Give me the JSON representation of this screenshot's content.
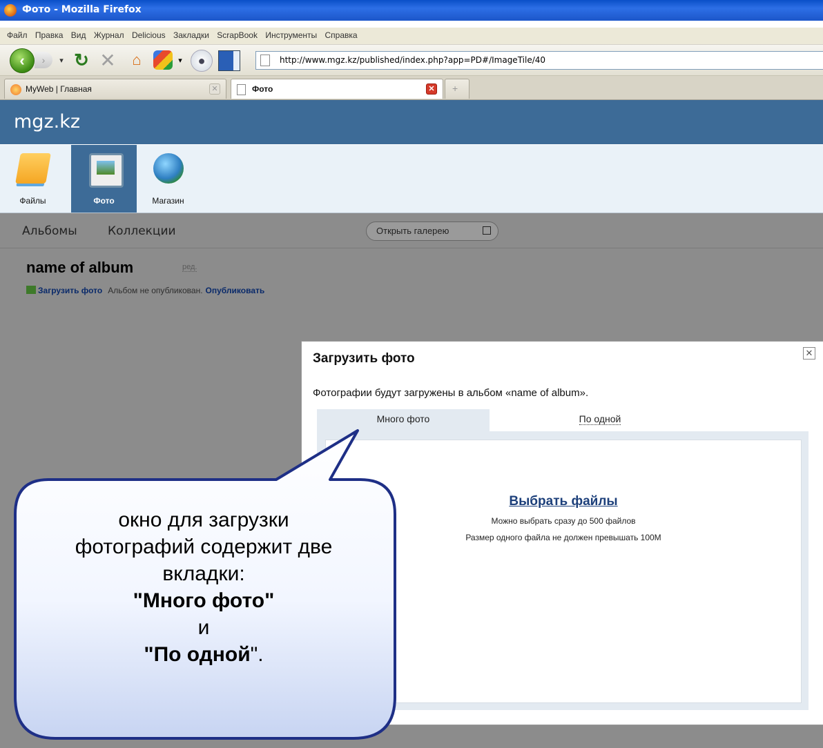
{
  "window": {
    "title": "Фото - Mozilla Firefox"
  },
  "menu": [
    "Файл",
    "Правка",
    "Вид",
    "Журнал",
    "Delicious",
    "Закладки",
    "ScrapBook",
    "Инструменты",
    "Справка"
  ],
  "address": {
    "url": "http://www.mgz.kz/published/index.php?app=PD#/ImageTile/40"
  },
  "tabs": [
    {
      "label": "MyWeb | Главная"
    },
    {
      "label": "Фото"
    }
  ],
  "site": {
    "logo": "mgz.kz"
  },
  "apps": [
    {
      "label": "Файлы"
    },
    {
      "label": "Фото"
    },
    {
      "label": "Магазин"
    }
  ],
  "subnav": {
    "albums": "Альбомы",
    "collections": "Коллекции",
    "gallery_button": "Открыть галерею"
  },
  "album": {
    "title": "name of album",
    "edit": "ред.",
    "upload_link": "Загрузить фото",
    "status": "Альбом не опубликован.",
    "publish_link": "Опубликовать"
  },
  "dialog": {
    "title": "Загрузить фото",
    "info": "Фотографии будут загружены в альбом «name of album».",
    "tab_many": "Много фото",
    "tab_one": "По одной",
    "pick_files": "Выбрать файлы",
    "hint1": "Можно выбрать сразу до 500 файлов",
    "hint2": "Размер одного файла не должен превышать 100М"
  },
  "callout": {
    "line1": "окно для загрузки",
    "line2": "фотографий содержит две",
    "line3": "вкладки:",
    "line4": "\"Много фото\"",
    "line5": "и",
    "line6a": "\"По одной",
    "line6b": "\"."
  }
}
